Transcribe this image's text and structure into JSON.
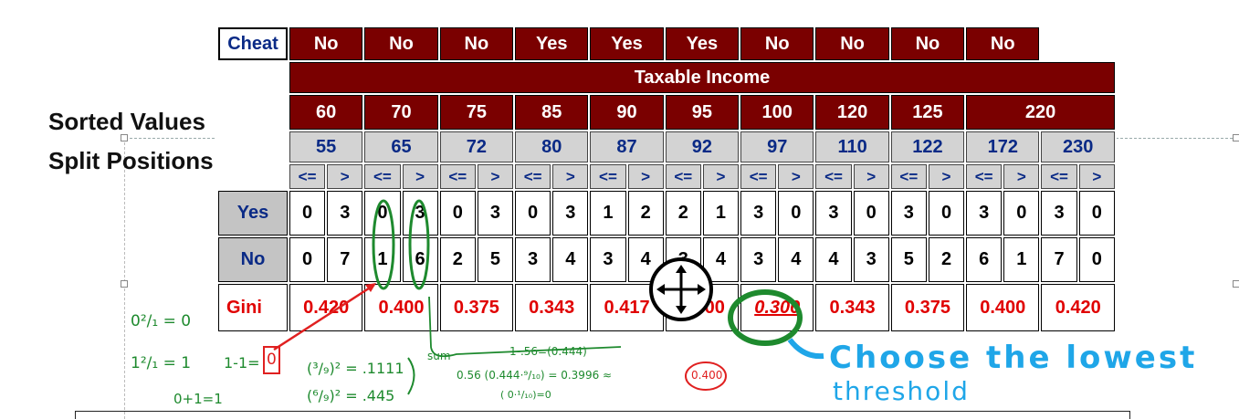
{
  "labels": {
    "sorted_values": "Sorted Values",
    "split_positions": "Split Positions"
  },
  "table": {
    "cheat_label": "Cheat",
    "cheat_values": [
      "No",
      "No",
      "No",
      "Yes",
      "Yes",
      "Yes",
      "No",
      "No",
      "No",
      "No"
    ],
    "attribute_title": "Taxable Income",
    "sorted_values": [
      "60",
      "70",
      "75",
      "85",
      "90",
      "95",
      "100",
      "120",
      "125",
      "220"
    ],
    "split_positions": [
      "55",
      "65",
      "72",
      "80",
      "87",
      "92",
      "97",
      "110",
      "122",
      "172",
      "230"
    ],
    "op_le": "<=",
    "op_gt": ">",
    "yes_label": "Yes",
    "no_label": "No",
    "gini_label": "Gini",
    "yes_counts": [
      [
        "0",
        "3"
      ],
      [
        "0",
        "3"
      ],
      [
        "0",
        "3"
      ],
      [
        "0",
        "3"
      ],
      [
        "1",
        "2"
      ],
      [
        "2",
        "1"
      ],
      [
        "3",
        "0"
      ],
      [
        "3",
        "0"
      ],
      [
        "3",
        "0"
      ],
      [
        "3",
        "0"
      ],
      [
        "3",
        "0"
      ]
    ],
    "no_counts": [
      [
        "0",
        "7"
      ],
      [
        "1",
        "6"
      ],
      [
        "2",
        "5"
      ],
      [
        "3",
        "4"
      ],
      [
        "3",
        "4"
      ],
      [
        "3",
        "4"
      ],
      [
        "3",
        "4"
      ],
      [
        "4",
        "3"
      ],
      [
        "5",
        "2"
      ],
      [
        "6",
        "1"
      ],
      [
        "7",
        "0"
      ]
    ],
    "gini": [
      "0.420",
      "0.400",
      "0.375",
      "0.343",
      "0.417",
      "0.400",
      "0.300",
      "0.343",
      "0.375",
      "0.400",
      "0.420"
    ],
    "best_index": 6
  },
  "annotations": {
    "choose_lowest_line1": "Choose the lowest",
    "choose_lowest_line2": "threshold",
    "note_0sq": "0²/₁ = 0",
    "note_1sq": "1²/₁ = 1",
    "note_0plus1": "0+1=1",
    "note_1minus1": "1-1=",
    "note_1minus1_result": "0",
    "note_frac1": "(³/₉)² = .1111",
    "note_frac2": "(⁶/₉)² = .445",
    "note_sum": "sum",
    "note_1_minus": "1-.56=(0.444)",
    "note_weighted": "0.56 (0.444·⁹/₁₀) = 0.3996 ≈",
    "note_weighted2": "( 0·¹/₁₀)=0",
    "note_approx": "0.400"
  },
  "colors": {
    "header_red": "#7a0000",
    "label_blue": "#0a2a86",
    "gini_red": "#e00000",
    "ink_green": "#1e8a2e",
    "ink_blue": "#1fa6e8"
  }
}
